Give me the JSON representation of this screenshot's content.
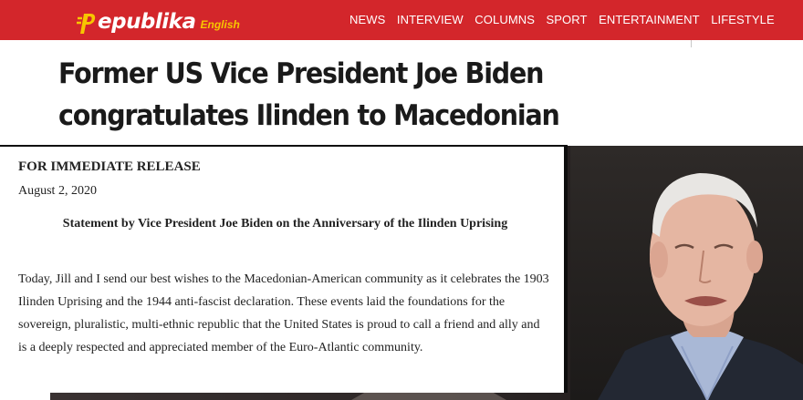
{
  "site": {
    "logo_main": "epublika",
    "logo_sub": "English"
  },
  "nav": {
    "items": [
      "NEWS",
      "INTERVIEW",
      "COLUMNS",
      "SPORT",
      "ENTERTAINMENT",
      "LIFESTYLE"
    ]
  },
  "article": {
    "headline": "Former US Vice President Joe Biden congratulates Ilinden to Macedonian Americans"
  },
  "press_release": {
    "label": "FOR IMMEDIATE RELEASE",
    "date": "August 2, 2020",
    "title": "Statement by Vice President Joe Biden on the Anniversary of the Ilinden Uprising",
    "body": "Today, Jill and I send our best wishes to the Macedonian-American community as it celebrates the 1903 Ilinden Uprising and the 1944 anti-fascist declaration. These events laid the foundations for the sovereign, pluralistic, multi-ethnic republic that the United States is proud to call a friend and ally and is a deeply respected and appreciated member of the Euro-Atlantic community."
  },
  "colors": {
    "brand_red": "#d3262b",
    "logo_yellow": "#f7c600"
  }
}
